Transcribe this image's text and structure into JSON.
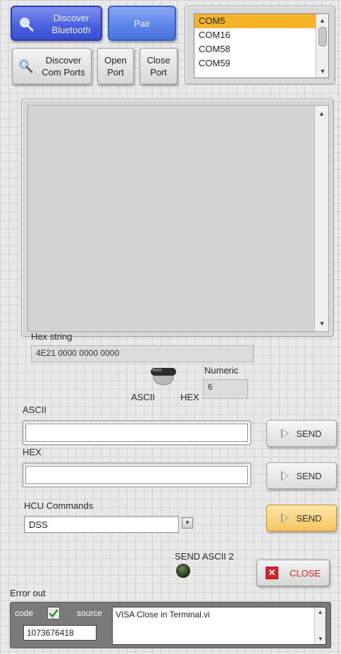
{
  "toolbar": {
    "discover_bluetooth": "Discover Bluetooth",
    "pair": "Pair",
    "discover_com_ports": "Discover Com Ports",
    "open_port": "Open Port",
    "close_port": "Close Port"
  },
  "com_list": {
    "items": [
      "COM5",
      "COM16",
      "COM58",
      "COM59"
    ],
    "selected": "COM5"
  },
  "hex_string": {
    "label": "Hex string",
    "value": "4E21 0000 0000 0000"
  },
  "mode_switch": {
    "left_label": "ASCII",
    "right_label": "HEX"
  },
  "numeric": {
    "label": "Numeric",
    "value": "6"
  },
  "ascii": {
    "label": "ASCII",
    "value": "",
    "send_label": "SEND"
  },
  "hex": {
    "label": "HEX",
    "value": "",
    "send_label": "SEND"
  },
  "hcu": {
    "label": "HCU Commands",
    "selected": "DSS",
    "send_label": "SEND"
  },
  "send_ascii_2": {
    "label": "SEND ASCII 2"
  },
  "close_button": {
    "label": "CLOSE"
  },
  "error_out": {
    "label": "Error out",
    "code_label": "code",
    "code_value": "1073676418",
    "source_label": "source",
    "source_value": "VISA Close in Terminal.vi"
  },
  "colors": {
    "selection": "#f5b32a",
    "blue_button": "#4a5fe0",
    "send_active": "#f6c660",
    "close_icon": "#d8232a"
  }
}
